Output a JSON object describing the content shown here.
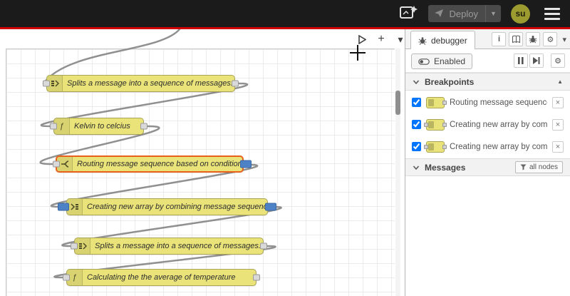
{
  "header": {
    "deploy_label": "Deploy",
    "avatar_text": "su"
  },
  "canvas": {
    "nodes": [
      {
        "label": "Splits a message into a sequence of messages.",
        "type": "split"
      },
      {
        "label": "Kelvin to celcius",
        "type": "function"
      },
      {
        "label": "Routing message sequence based on condition",
        "type": "switch",
        "selected": true
      },
      {
        "label": "Creating new array by combining message sequence",
        "type": "join"
      },
      {
        "label": "Splits a message into a sequence of messages.",
        "type": "split"
      },
      {
        "label": "Calculating the the average of temperature",
        "type": "function"
      }
    ]
  },
  "sidebar": {
    "tab_label": "debugger",
    "enabled_label": "Enabled",
    "breakpoints_title": "Breakpoints",
    "messages_title": "Messages",
    "filter_label": "all nodes",
    "breakpoints": [
      {
        "label": "Routing message sequence based on condition"
      },
      {
        "label": "Creating new array by combining message sequence"
      },
      {
        "label": "Creating new array by combining message sequence"
      }
    ]
  },
  "icons": {
    "caret_down": "▾",
    "menu_caret": "▼",
    "close": "×",
    "info": "i",
    "plus": "+",
    "gear": "⚙",
    "scroll_up": "▲",
    "fn": "ƒ"
  },
  "colors": {
    "header_bg": "#1b1b1b",
    "accent_red": "#d00000",
    "node_yellow": "#e9e379",
    "node_border": "#aaa455",
    "selected_orange": "#e8611c",
    "breakpoint_blue": "#4e82c6",
    "wire_gray": "#909090",
    "avatar_olive": "#9b9b30"
  }
}
